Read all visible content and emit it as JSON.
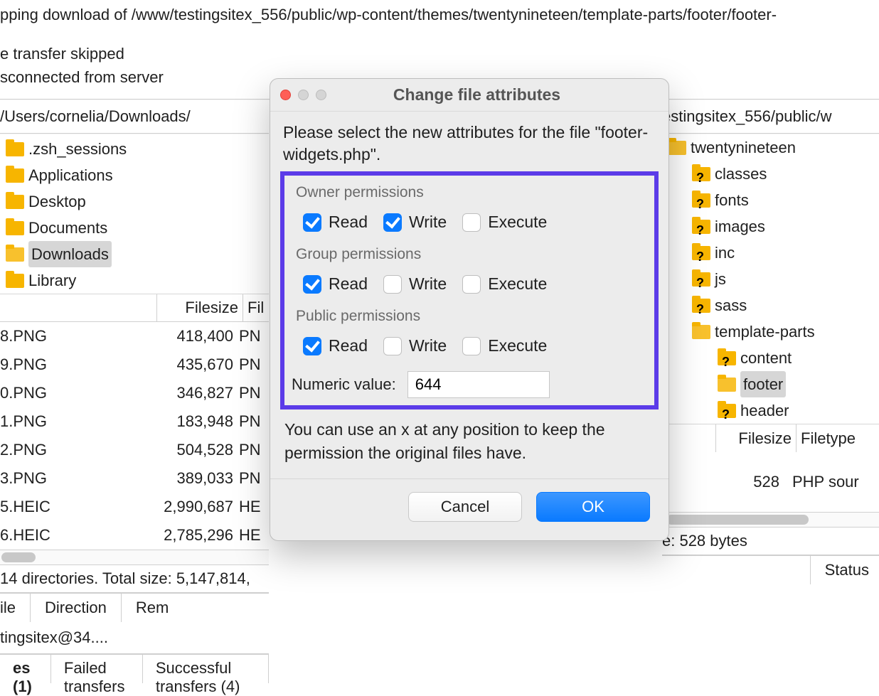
{
  "log": {
    "l1": "pping download of /www/testingsitex_556/public/wp-content/themes/twentynineteen/template-parts/footer/footer-",
    "l2": "e transfer skipped",
    "l3": "sconnected from server"
  },
  "local": {
    "path": "/Users/cornelia/Downloads/",
    "folders": [
      {
        "label": ".zsh_sessions",
        "sel": false
      },
      {
        "label": "Applications",
        "sel": false
      },
      {
        "label": "Desktop",
        "sel": false
      },
      {
        "label": "Documents",
        "sel": false
      },
      {
        "label": "Downloads",
        "sel": true
      },
      {
        "label": "Library",
        "sel": false
      }
    ],
    "col_filesize": "Filesize",
    "col_type_prefix": "Fil",
    "files": [
      {
        "name": "8.PNG",
        "size": "418,400",
        "type": "PN"
      },
      {
        "name": "9.PNG",
        "size": "435,670",
        "type": "PN"
      },
      {
        "name": "0.PNG",
        "size": "346,827",
        "type": "PN"
      },
      {
        "name": "1.PNG",
        "size": "183,948",
        "type": "PN"
      },
      {
        "name": "2.PNG",
        "size": "504,528",
        "type": "PN"
      },
      {
        "name": "3.PNG",
        "size": "389,033",
        "type": "PN"
      },
      {
        "name": "5.HEIC",
        "size": "2,990,687",
        "type": "HE"
      },
      {
        "name": "6.HEIC",
        "size": "2,785,296",
        "type": "HE"
      }
    ],
    "status": "14 directories. Total size: 5,147,814,"
  },
  "remote": {
    "path": "estingsitex_556/public/w",
    "tree_root": "twentynineteen",
    "items": [
      "classes",
      "fonts",
      "images",
      "inc",
      "js",
      "sass"
    ],
    "tp_label": "template-parts",
    "tp_children": [
      {
        "label": "content",
        "sel": false
      },
      {
        "label": "footer",
        "sel": true
      },
      {
        "label": "header",
        "sel": false
      }
    ],
    "col_filesize": "Filesize",
    "col_filetype": "Filetype",
    "row_size": "528",
    "row_type": "PHP sour",
    "status": "e: 528 bytes"
  },
  "queue": {
    "h_file": "ile",
    "h_direction": "Direction",
    "h_remote": "Rem",
    "h_status": "Status",
    "row1": "tingsitex@34...."
  },
  "tabs": {
    "t0_prefix": "es (1)",
    "t1": "Failed transfers",
    "t2": "Successful transfers (4)"
  },
  "dialog": {
    "title": "Change file attributes",
    "instr": "Please select the new attributes for the file \"footer-widgets.php\".",
    "owner_label": "Owner permissions",
    "group_label": "Group permissions",
    "public_label": "Public permissions",
    "read": "Read",
    "write": "Write",
    "execute": "Execute",
    "owner": {
      "read": true,
      "write": true,
      "execute": false
    },
    "group": {
      "read": true,
      "write": false,
      "execute": false
    },
    "public": {
      "read": true,
      "write": false,
      "execute": false
    },
    "numeric_label": "Numeric value:",
    "numeric_value": "644",
    "hint": "You can use an x at any position to keep the permission the original files have.",
    "cancel": "Cancel",
    "ok": "OK"
  }
}
